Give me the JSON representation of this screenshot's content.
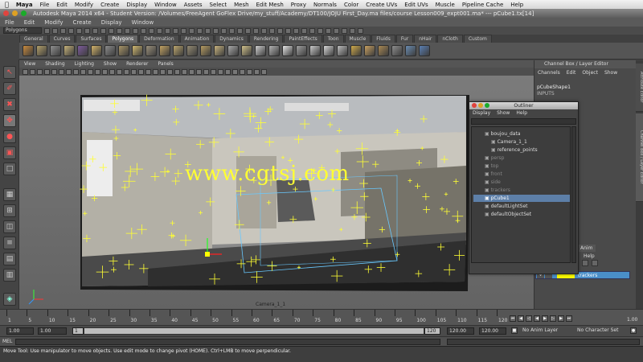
{
  "mac_menubar": {
    "apple": "",
    "items": [
      "Maya",
      "File",
      "Edit",
      "Modify",
      "Create",
      "Display",
      "Window",
      "Assets",
      "Select",
      "Mesh",
      "Edit Mesh",
      "Proxy",
      "Normals",
      "Color",
      "Create UVs",
      "Edit UVs",
      "Muscle",
      "Pipeline Cache",
      "Help"
    ]
  },
  "window": {
    "title": "Autodesk Maya 2014 x64 - Student Version: /Volumes/FreeAgent GoFlex Drive/my_stuff/Academy/DT100/JOJU First_Day.ma files/course Lesson009_expt001.ma* --- pCube1.tx[14]"
  },
  "status_line": {
    "mode": "Polygons"
  },
  "shelf": {
    "tabs": [
      "General",
      "Curves",
      "Surfaces",
      "Polygons",
      "Deformation",
      "Animation",
      "Dynamics",
      "Rendering",
      "PaintEffects",
      "Toon",
      "Muscle",
      "Fluids",
      "Fur",
      "nHair",
      "nCloth",
      "Custom"
    ],
    "active_tab": "Polygons",
    "icon_colors": [
      "#c98a3d",
      "#b3a06a",
      "#8f8f8f",
      "#c6b27a",
      "#7d5b9c",
      "#d3b36a",
      "#8b8b8b",
      "#a89466",
      "#d1b870",
      "#9a8f7a",
      "#c2a261",
      "#bba56d",
      "#948a72",
      "#b59b60",
      "#c8b37e",
      "#a8a8a8",
      "#d0c08a",
      "#cfcfcf",
      "#b3b3b3",
      "#e6e6e6",
      "#a0a0a0",
      "#c9c9c9",
      "#d8d8d8",
      "#bdbdbd",
      "#cfa94a",
      "#c8a060",
      "#a98853",
      "#8d8d8d",
      "#6a8bb0",
      "#5a7fb3"
    ]
  },
  "viewport": {
    "menu": [
      "View",
      "Shading",
      "Lighting",
      "Show",
      "Renderer",
      "Panels"
    ],
    "camera_label": "Camera_1_1",
    "watermark": "www.cgtsj.com"
  },
  "channel_box": {
    "header": "Channel Box / Layer Editor",
    "menu": [
      "Channels",
      "Edit",
      "Object",
      "Show"
    ],
    "object_name": "pCubeShape1",
    "inputs_label": "INPUTS",
    "side_tabs": [
      "Attribute Editor",
      "Channel Box / Layer Editor"
    ]
  },
  "outliner": {
    "title": "Outliner",
    "menu": [
      "Display",
      "Show",
      "Help"
    ],
    "items": [
      {
        "label": "boujou_data",
        "indent": 0,
        "state": "normal"
      },
      {
        "label": "Camera_1_1",
        "indent": 1,
        "state": "normal"
      },
      {
        "label": "reference_points",
        "indent": 1,
        "state": "normal"
      },
      {
        "label": "persp",
        "indent": 0,
        "state": "dim"
      },
      {
        "label": "top",
        "indent": 0,
        "state": "dim"
      },
      {
        "label": "front",
        "indent": 0,
        "state": "dim"
      },
      {
        "label": "side",
        "indent": 0,
        "state": "dim"
      },
      {
        "label": "trackers",
        "indent": 0,
        "state": "dim"
      },
      {
        "label": "pCube1",
        "indent": 0,
        "state": "selected"
      },
      {
        "label": "defaultLightSet",
        "indent": 0,
        "state": "normal"
      },
      {
        "label": "defaultObjectSet",
        "indent": 0,
        "state": "normal"
      }
    ]
  },
  "layer_editor": {
    "tabs": [
      "Anim"
    ],
    "help": "Help",
    "layer": {
      "visible": "V",
      "color": "#ffff00",
      "name": "trackers"
    }
  },
  "timeline": {
    "ticks": [
      "1",
      "5",
      "10",
      "15",
      "20",
      "25",
      "30",
      "35",
      "40",
      "45",
      "50",
      "55",
      "60",
      "65",
      "70",
      "75",
      "80",
      "85",
      "90",
      "95",
      "100",
      "105",
      "110",
      "115",
      "120"
    ],
    "end_label": "1.00"
  },
  "range": {
    "start": "1.00",
    "current": "1.00",
    "range_start": "1",
    "range_end": "120",
    "end": "120.00",
    "anim_end": "120.00",
    "anim_layer": "No Anim Layer",
    "char_set": "No Character Set"
  },
  "command_line": {
    "label": "MEL"
  },
  "help_line": "Move Tool: Use manipulator to move objects. Use edit mode to change pivot (HOME). Ctrl+LMB to move perpendicular."
}
